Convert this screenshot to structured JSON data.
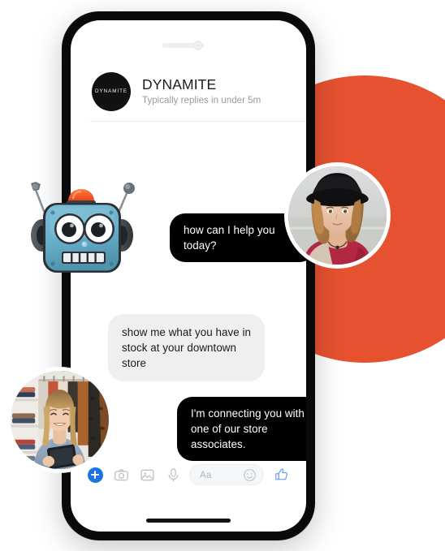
{
  "scene": {
    "background_color": "#ffffff",
    "accent_orange": "#E65230",
    "accent_blue": "#1b74e4"
  },
  "phone": {
    "frame_color": "#0a0a0a",
    "screen_color": "#ffffff",
    "speaker_icon": "speaker-slot",
    "camera_icon": "front-camera-dot",
    "home_indicator": "home-indicator-bar"
  },
  "chat": {
    "header": {
      "avatar_text": "DYNAMITE",
      "avatar_icon": "brand-avatar",
      "title": "DYNAMITE",
      "status": "Typically replies in under 5m"
    },
    "messages": [
      {
        "id": "msg-1",
        "sender": "bot",
        "align": "right",
        "text": "how can I help you today?",
        "bubble_color": "#000000",
        "text_color": "#ffffff"
      },
      {
        "id": "msg-2",
        "sender": "user",
        "align": "left",
        "text": "show me what you have in stock at your downtown store",
        "bubble_color": "#efefef",
        "text_color": "#1b1b1b"
      },
      {
        "id": "msg-3",
        "sender": "bot",
        "align": "right",
        "text": "I'm connecting you with one of our store associates.",
        "bubble_color": "#000000",
        "text_color": "#ffffff"
      }
    ],
    "composer": {
      "add_icon": "plus-circle-icon",
      "camera_icon": "camera-icon",
      "gallery_icon": "photo-gallery-icon",
      "mic_icon": "microphone-icon",
      "input_placeholder": "Aa",
      "input_value": "",
      "emoji_icon": "smiley-face-icon",
      "like_icon": "thumbs-up-icon"
    }
  },
  "decor": {
    "orange_circle": "orange-decorative-circle",
    "robot_mascot": "robot-mascot-illustration",
    "photo_woman_hat": "photo-woman-with-hat",
    "photo_woman_tablet": "photo-store-associate-with-tablet"
  }
}
